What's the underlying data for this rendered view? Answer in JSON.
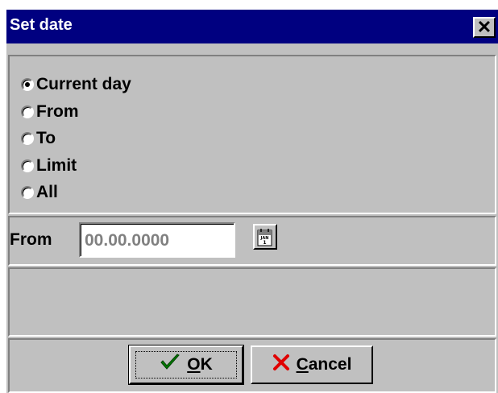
{
  "window": {
    "title": "Set date",
    "close_icon": "close-icon"
  },
  "radio_group": {
    "options": [
      {
        "label": "Current day",
        "selected": true
      },
      {
        "label": "From",
        "selected": false
      },
      {
        "label": "To",
        "selected": false
      },
      {
        "label": "Limit",
        "selected": false
      },
      {
        "label": "All",
        "selected": false
      }
    ]
  },
  "date_field": {
    "label": "From",
    "value": "00.00.0000",
    "calendar_icon": "calendar-icon",
    "calendar_icon_text": "JAN 1"
  },
  "buttons": {
    "ok": {
      "underline_char": "O",
      "rest": "K",
      "icon": "checkmark-icon",
      "icon_color": "#008000"
    },
    "cancel": {
      "underline_char": "C",
      "rest": "ancel",
      "icon": "x-icon",
      "icon_color": "#ff0000"
    }
  },
  "colors": {
    "titlebar": "#000080",
    "face": "#c0c0c0",
    "disabled_text": "#808080"
  }
}
